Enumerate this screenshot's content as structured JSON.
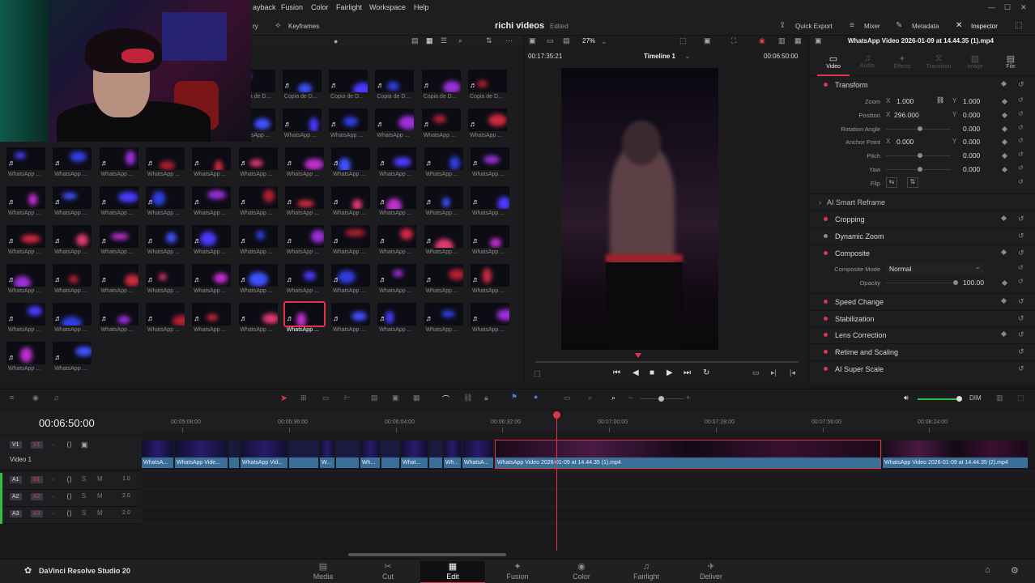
{
  "menu": [
    "ayback",
    "Fusion",
    "Color",
    "Fairlight",
    "Workspace",
    "Help"
  ],
  "titlebar": {
    "keyframes": "Keyframes",
    "project": "richi videos",
    "status": "Edited",
    "quick_export": "Quick Export",
    "mixer": "Mixer",
    "metadata": "Metadata",
    "inspector": "Inspector",
    "partial_label": "ry"
  },
  "viewer": {
    "zoom": "27%",
    "timecode_left": "00:17:35:21",
    "timeline_name": "Timeline 1",
    "timecode_right": "00:06:50:00"
  },
  "inspector": {
    "clip_name": "WhatsApp Video 2026-01-09 at 14.44.35 (1).mp4",
    "tabs": [
      "Video",
      "Audio",
      "Effects",
      "Transition",
      "Image",
      "File"
    ],
    "transform": {
      "title": "Transform",
      "zoom_label": "Zoom",
      "zoom_x": "1.000",
      "zoom_y": "1.000",
      "position_label": "Position",
      "pos_x": "296.000",
      "pos_y": "0.000",
      "rotation_label": "Rotation Angle",
      "rotation": "0.000",
      "anchor_label": "Anchor Point",
      "anchor_x": "0.000",
      "anchor_y": "0.000",
      "pitch_label": "Pitch",
      "pitch": "0.000",
      "yaw_label": "Yaw",
      "yaw": "0.000",
      "flip_label": "Flip",
      "axis_x": "X",
      "axis_y": "Y"
    },
    "smart_reframe": "AI Smart Reframe",
    "cropping": "Cropping",
    "dynamic_zoom": "Dynamic Zoom",
    "composite": {
      "title": "Composite",
      "mode_label": "Composite Mode",
      "mode": "Normal",
      "opacity_label": "Opacity",
      "opacity": "100.00"
    },
    "sections": [
      "Speed Change",
      "Stabilization",
      "Lens Correction",
      "Retime and Scaling",
      "AI Super Scale"
    ]
  },
  "media_pool": {
    "top_labels": [
      "Copia de D...",
      "Copia de D...",
      "Copia de D...",
      "Copia de D...",
      "Copia de D...",
      "Copia de D..."
    ],
    "clip_label": "WhatsApp ...",
    "partial_labels": [
      "Copia de D..."
    ]
  },
  "timeline": {
    "timecode": "00:06:50:00",
    "ruler": [
      "00:05:08:00",
      "00:05:36:00",
      "00:06:04:00",
      "00:06:32:00",
      "00:07:00:00",
      "00:07:28:00",
      "00:07:56:00",
      "00:08:24:00"
    ],
    "v1": {
      "badge": "V1",
      "name": "Video 1"
    },
    "audio": [
      {
        "badge": "A1",
        "level": "1.0"
      },
      {
        "badge": "A2",
        "level": "2.0"
      },
      {
        "badge": "A3",
        "level": "2.0"
      }
    ],
    "clips": [
      "WhatsA...",
      "WhatsApp Vide...",
      "WhatsApp Vid...",
      "W...",
      "Wh...",
      "What...",
      "Wh...",
      "WhatsA...",
      "WhatsApp Video 2026-01-09 at 14.44.35 (1).mp4",
      "WhatsApp Video 2026-01-09 at 14.44.35 (2).mp4"
    ],
    "dim": "DIM"
  },
  "bottom": {
    "app_name": "DaVinci Resolve Studio 20",
    "pages": [
      "Media",
      "Cut",
      "Edit",
      "Fusion",
      "Color",
      "Fairlight",
      "Deliver"
    ],
    "active_page": "Edit"
  }
}
